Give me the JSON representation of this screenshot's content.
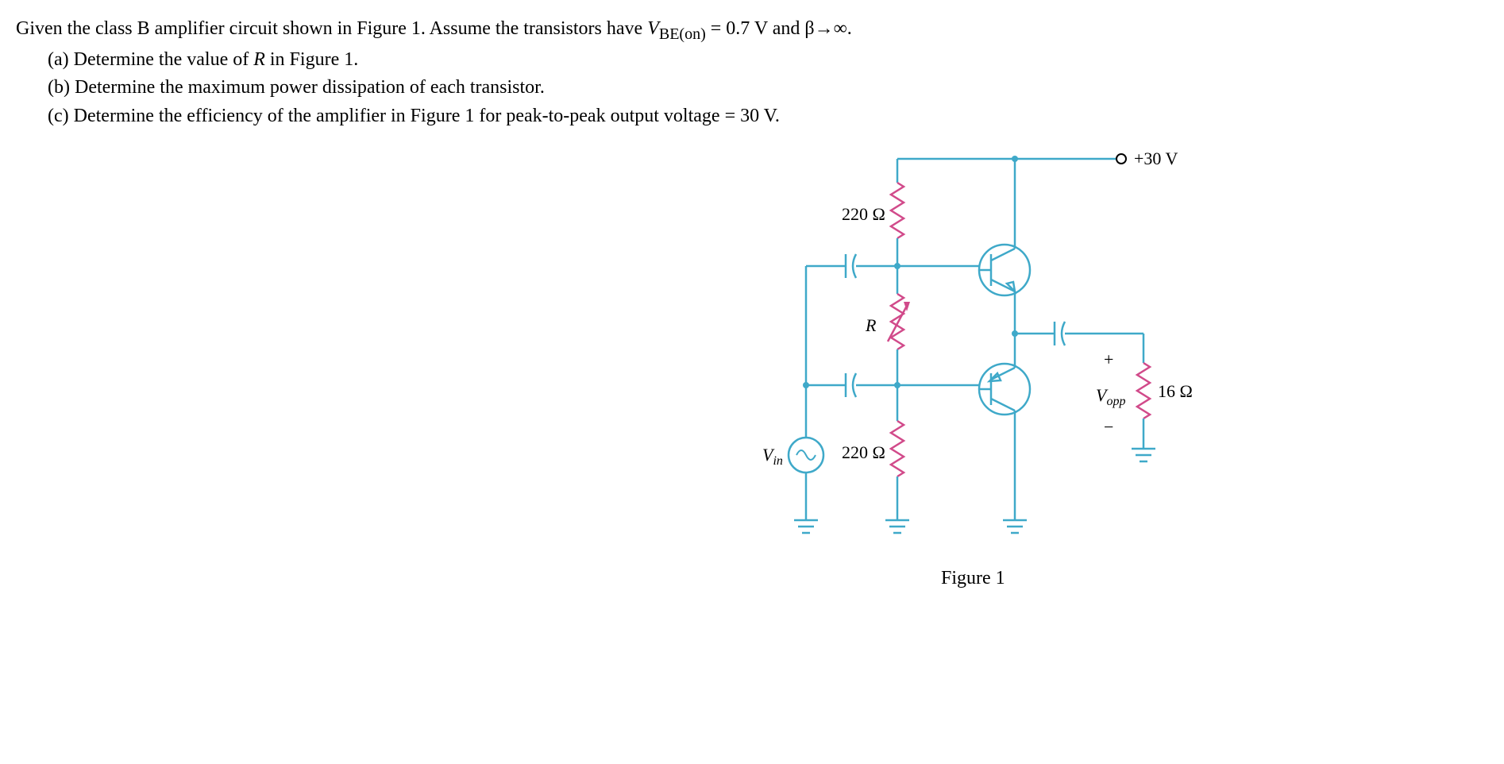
{
  "question": {
    "main": "Given the class B amplifier circuit shown in Figure 1. Assume the transistors have ",
    "vbe_var": "V",
    "vbe_sub": "BE(on)",
    "vbe_rest": " = 0.7 V and β→∞.",
    "a": "(a)  Determine the value of ",
    "a_var": "R",
    "a_rest": " in Figure 1.",
    "b": "(b)  Determine the maximum power dissipation of each transistor.",
    "c": "(c)  Determine the efficiency of the amplifier in Figure 1 for peak-to-peak output voltage = 30 V."
  },
  "figure": {
    "vcc": "+30 V",
    "r_top": "220 Ω",
    "r_mid": "R",
    "r_bottom": "220 Ω",
    "vin": "V",
    "vin_sub": "in",
    "vout": "V",
    "vout_sub": "opp",
    "rload": "16 Ω",
    "plus": "+",
    "minus": "−",
    "caption": "Figure 1"
  }
}
